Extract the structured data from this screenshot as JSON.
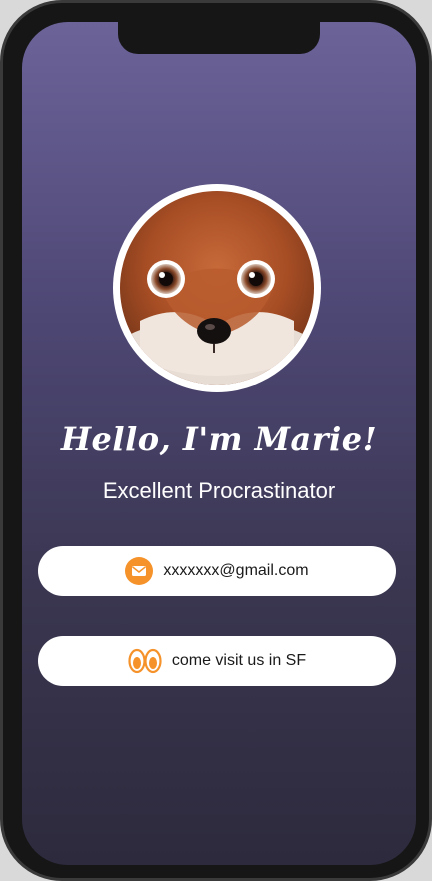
{
  "profile": {
    "greeting": "Hello, I'm Marie!",
    "subtitle": "Excellent Procrastinator",
    "avatar_icon": "fox-avatar"
  },
  "contacts": {
    "email": {
      "label": "xxxxxxx@gmail.com",
      "icon": "envelope-icon",
      "icon_color": "#f5922a"
    },
    "location": {
      "label": "come visit us in SF",
      "icon": "eyes-icon",
      "icon_color": "#f5922a"
    }
  },
  "colors": {
    "gradient_top": "#6c6399",
    "gradient_bottom": "#2d2a3d",
    "accent": "#f5922a"
  }
}
